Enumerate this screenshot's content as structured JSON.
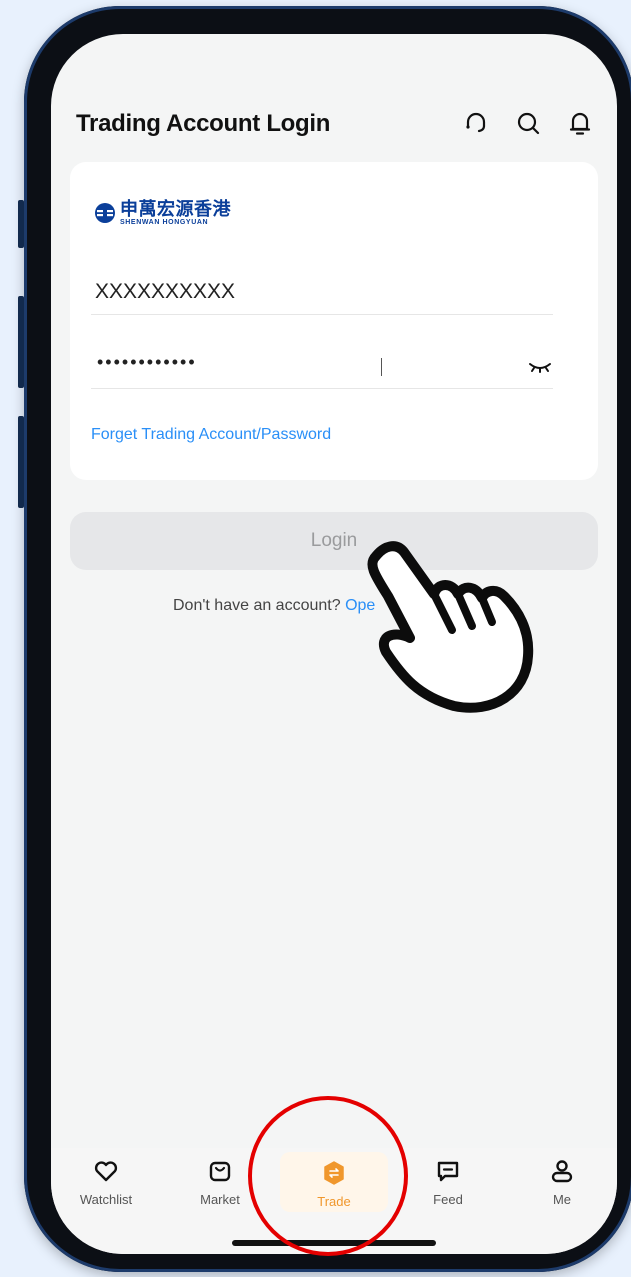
{
  "header": {
    "title": "Trading Account Login",
    "icons": [
      "headset-icon",
      "search-icon",
      "bell-icon"
    ]
  },
  "login_card": {
    "broker_logo": {
      "name_cn": "申萬宏源香港",
      "name_en": "SHENWAN HONGYUAN"
    },
    "account_field": {
      "value": "XXXXXXXXXX"
    },
    "password_field": {
      "masked_value": "••••••••••••"
    },
    "forgot_link": "Forget Trading Account/Password"
  },
  "login_button": "Login",
  "signup": {
    "prompt": "Don't have an account?",
    "link": "Ope"
  },
  "tabbar": {
    "items": [
      {
        "label": "Watchlist",
        "icon": "heart-icon"
      },
      {
        "label": "Market",
        "icon": "shopping-bag-icon"
      },
      {
        "label": "Trade",
        "icon": "trade-hexagon-icon",
        "active": true
      },
      {
        "label": "Feed",
        "icon": "message-icon"
      },
      {
        "label": "Me",
        "icon": "person-icon"
      }
    ]
  },
  "colors": {
    "accent_blue": "#2a8ff7",
    "active_orange": "#f0972c",
    "brand_blue": "#0b3f9a",
    "highlight_red": "#e40000"
  }
}
